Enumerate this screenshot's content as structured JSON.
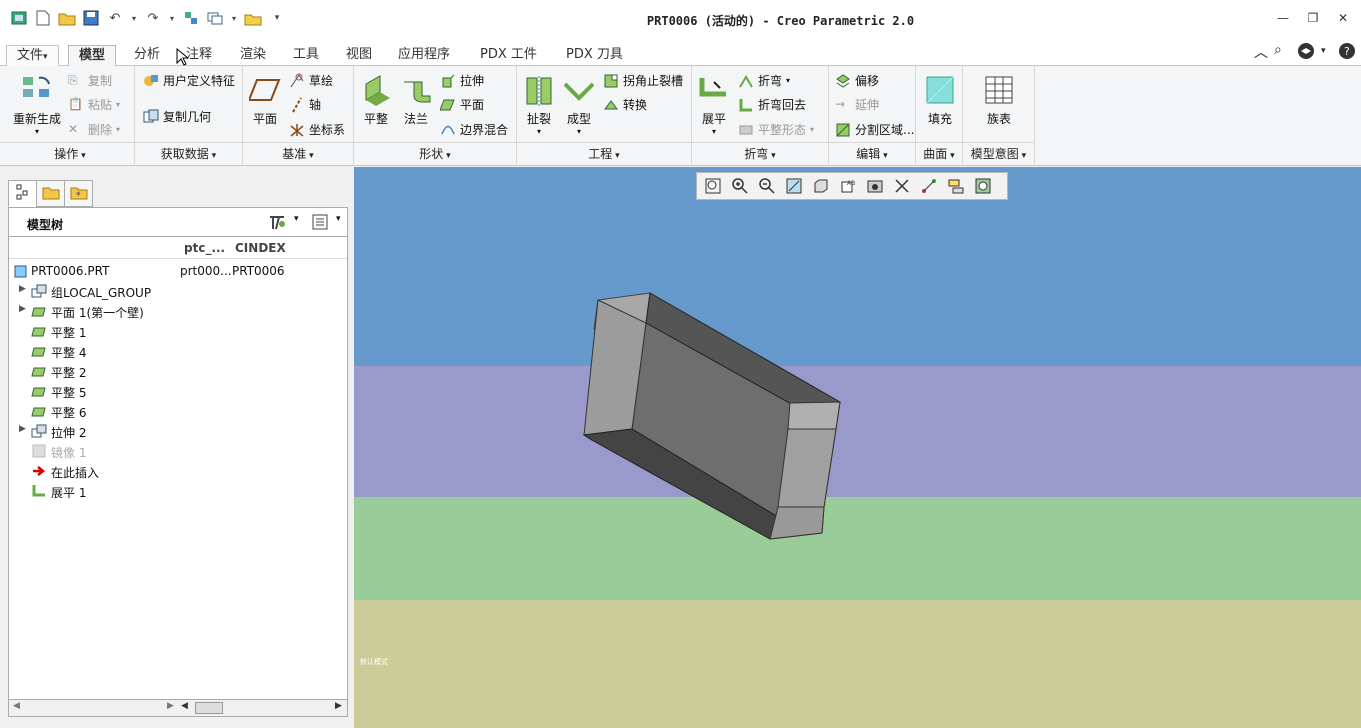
{
  "window": {
    "title": "PRT0006 (活动的) - Creo Parametric 2.0"
  },
  "tabs": [
    {
      "label": "文件",
      "dropdown": "▾"
    },
    {
      "label": "模型"
    },
    {
      "label": "分析"
    },
    {
      "label": "注释"
    },
    {
      "label": "渲染"
    },
    {
      "label": "工具"
    },
    {
      "label": "视图"
    },
    {
      "label": "应用程序"
    },
    {
      "label": "PDX 工件"
    },
    {
      "label": "PDX 刀具"
    }
  ],
  "ribbon": {
    "ops": {
      "regen": "重新生成",
      "copy": "复制",
      "paste": "粘贴",
      "delete": "删除",
      "group": "操作"
    },
    "get_data": {
      "udf": "用户定义特征",
      "copy_geom": "复制几何",
      "group": "获取数据"
    },
    "datum": {
      "plane": "平面",
      "sketch": "草绘",
      "axis": "轴",
      "csys": "坐标系",
      "group": "基准"
    },
    "shapes": {
      "flat": "平整",
      "flange": "法兰",
      "extrude": "拉伸",
      "planar": "平面",
      "blend": "边界混合",
      "group": "形状"
    },
    "engineering": {
      "rip": "扯裂",
      "form": "成型",
      "corner_relief": "拐角止裂槽",
      "convert": "转换",
      "group": "工程"
    },
    "bends": {
      "unbend": "展平",
      "bend": "折弯",
      "bend_back": "折弯回去",
      "flat_state": "平整形态",
      "group": "折弯"
    },
    "editing": {
      "offset": "偏移",
      "extend": "延伸",
      "split": "分割区域...",
      "group": "编辑"
    },
    "surface": {
      "fill": "填充",
      "group": "曲面"
    },
    "intent": {
      "table": "族表",
      "group": "模型意图"
    }
  },
  "model_tree": {
    "title": "模型树",
    "columns": [
      "ptc_...",
      "CINDEX"
    ],
    "rows": [
      {
        "name": "PRT0006.PRT",
        "c1": "prt000...",
        "c2": "PRT0006",
        "level": 0,
        "expand": false
      },
      {
        "name": "组LOCAL_GROUP",
        "level": 1,
        "expand": true
      },
      {
        "name": "平面 1(第一个壁)",
        "level": 1,
        "expand": true
      },
      {
        "name": "平整 1",
        "level": 1
      },
      {
        "name": "平整 4",
        "level": 1
      },
      {
        "name": "平整 2",
        "level": 1
      },
      {
        "name": "平整 5",
        "level": 1
      },
      {
        "name": "平整 6",
        "level": 1
      },
      {
        "name": "拉伸 2",
        "level": 1,
        "expand": true
      },
      {
        "name": "镜像 1",
        "level": 1,
        "dim": true
      },
      {
        "name": "在此插入",
        "level": 1
      },
      {
        "name": "展平 1",
        "level": 1
      }
    ]
  },
  "viewport": {
    "corner_text": "默认模式"
  },
  "colors": {
    "sky": "#6699cc",
    "band2": "#9999cc",
    "band3": "#99cc99",
    "band4": "#cccc99"
  }
}
